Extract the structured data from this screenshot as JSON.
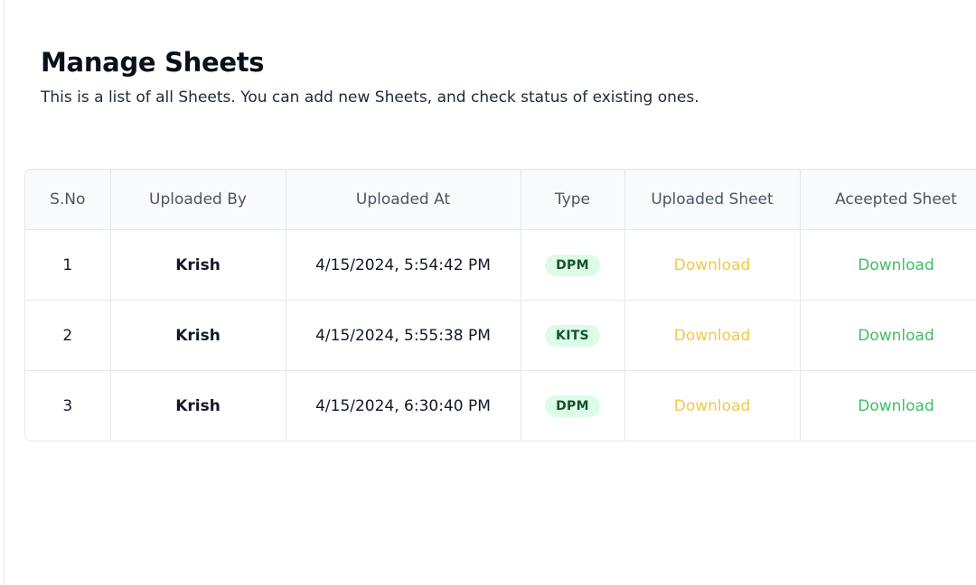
{
  "header": {
    "title": "Manage Sheets",
    "subtitle": "This is a list of all Sheets. You can add new Sheets, and check status of existing ones."
  },
  "table": {
    "columns": [
      "S.No",
      "Uploaded By",
      "Uploaded At",
      "Type",
      "Uploaded Sheet",
      "Aceepted Sheet"
    ],
    "rows": [
      {
        "sno": "1",
        "uploaded_by": "Krish",
        "uploaded_at": "4/15/2024, 5:54:42 PM",
        "type": "DPM",
        "uploaded_sheet": "Download",
        "accepted_sheet": "Download"
      },
      {
        "sno": "2",
        "uploaded_by": "Krish",
        "uploaded_at": "4/15/2024, 5:55:38 PM",
        "type": "KITS",
        "uploaded_sheet": "Download",
        "accepted_sheet": "Download"
      },
      {
        "sno": "3",
        "uploaded_by": "Krish",
        "uploaded_at": "4/15/2024, 6:30:40 PM",
        "type": "DPM",
        "uploaded_sheet": "Download",
        "accepted_sheet": "Download"
      }
    ]
  },
  "colors": {
    "uploaded_download": "#f2c84b",
    "accepted_download": "#3fbf63",
    "badge_bg": "#dcfce7",
    "badge_text": "#14532d"
  }
}
